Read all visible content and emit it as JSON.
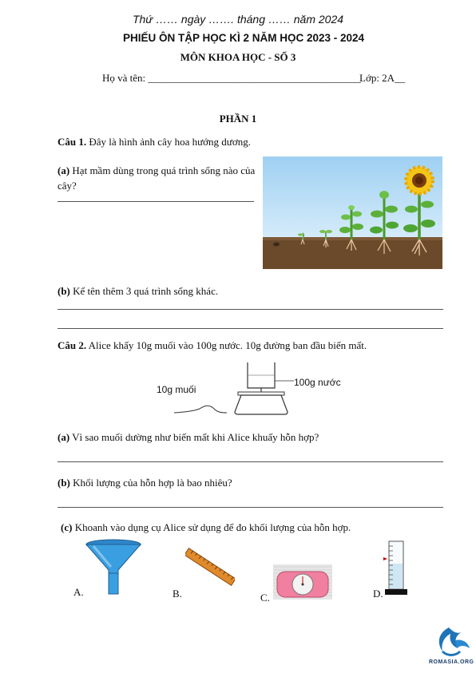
{
  "header": {
    "date_line": "Thứ …… ngày ……. tháng …… năm 2024",
    "title": "PHIẾU ÔN TẬP HỌC KÌ 2 NĂM HỌC 2023 - 2024",
    "subject": "MÔN KHOA HỌC - SỐ 3",
    "name_label": "Họ và tên: ",
    "name_blank": "_________________________________________",
    "class_label": "Lớp: 2A__"
  },
  "part1": {
    "heading": "PHẦN 1",
    "q1": {
      "label": "Câu 1.",
      "text": " Đây là hình ảnh cây hoa hướng dương.",
      "a_label": "(a)",
      "a_text": " Hạt mầm dùng trong quá trình sống nào của cây?",
      "b_label": "(b)",
      "b_text": " Kể tên thêm 3 quá trình sống khác."
    },
    "q2": {
      "label": "Câu 2.",
      "text": " Alice  khấy 10g muối vào 100g nước. 10g đường ban đầu biến mất.",
      "salt_label": "10g muối",
      "water_label": "100g nước",
      "a_label": "(a)",
      "a_text": " Vì sao muối dường như biến mất khi Alice khuấy hỗn hợp?",
      "b_label": "(b)",
      "b_text": " Khối lượng của hỗn hợp là bao nhiêu?",
      "c_label": "(c)",
      "c_text": " Khoanh vào dụng cụ Alice sử dụng để đo khối lượng của hỗn hợp.",
      "options": [
        "A.",
        "B.",
        "C.",
        "D."
      ]
    }
  },
  "watermark": {
    "text": "ROMASIA.ORG"
  },
  "colors": {
    "soil": "#6b4a2b",
    "sky": "#cfe8f8",
    "funnel": "#3a9fe0",
    "ruler": "#e08a2c"
  }
}
